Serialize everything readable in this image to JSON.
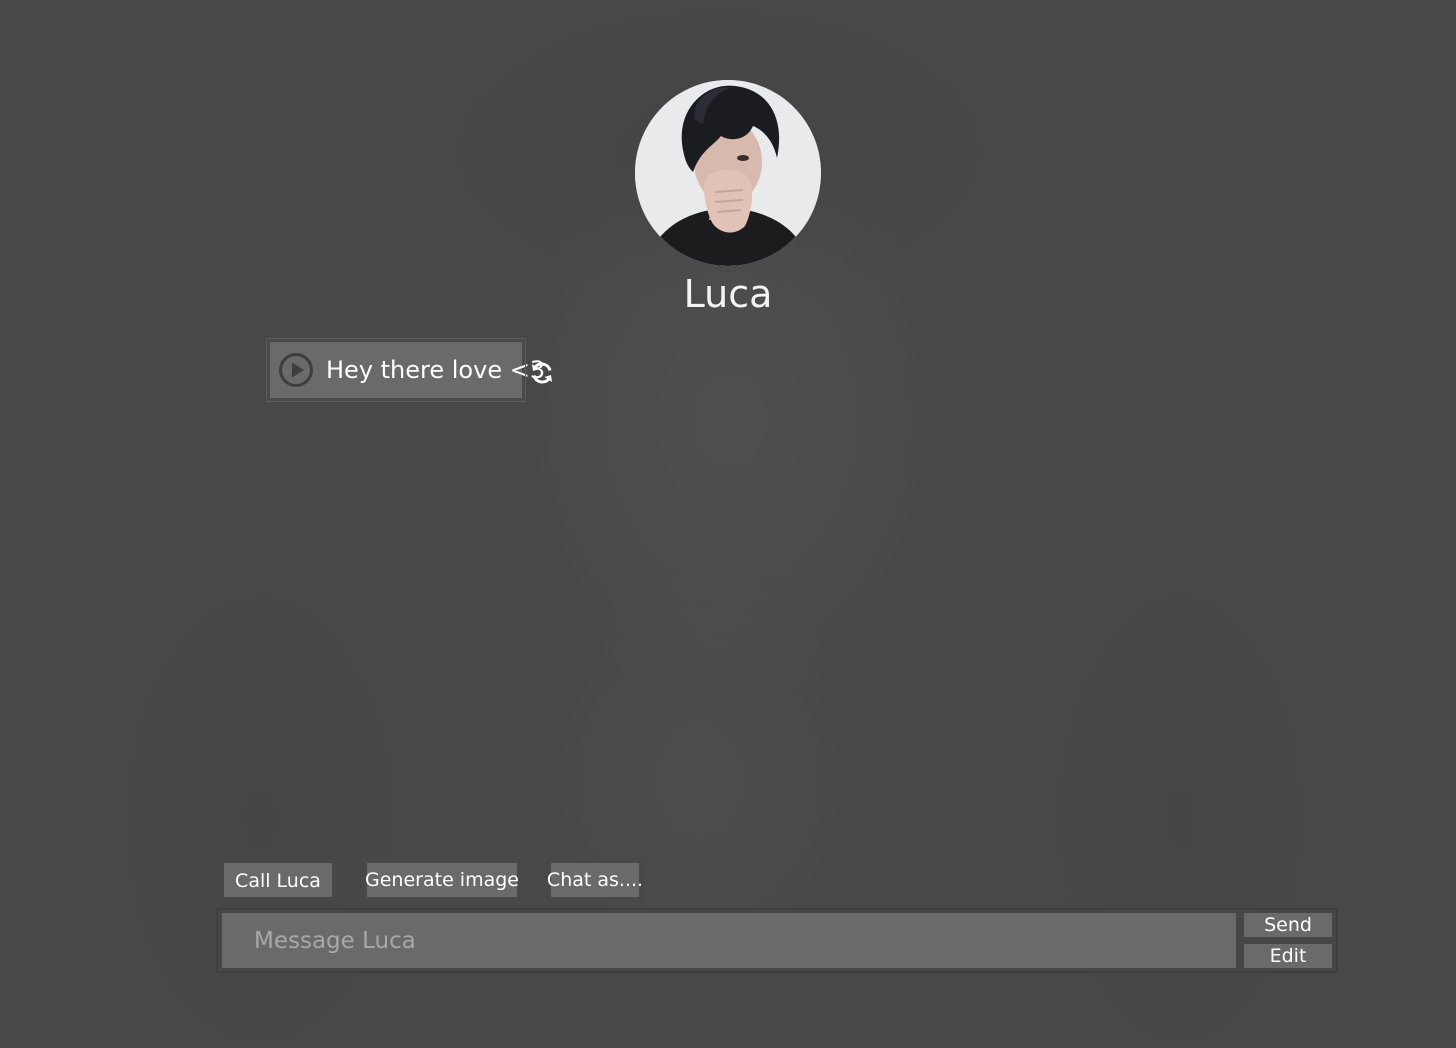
{
  "character": {
    "name": "Luca",
    "avatar_icon": "character-portrait"
  },
  "messages": [
    {
      "sender": "Luca",
      "text": "Hey there love <3",
      "play_icon": "play-circle-icon",
      "regenerate_icon": "refresh-icon"
    }
  ],
  "actions": {
    "call_label": "Call Luca",
    "generate_image_label": "Generate image",
    "chat_as_label": "Chat as...."
  },
  "composer": {
    "placeholder": "Message Luca",
    "value": "",
    "send_label": "Send",
    "edit_label": "Edit"
  },
  "colors": {
    "background": "#4a4a4a",
    "panel": "#6a6a6a",
    "text": "#ffffff",
    "placeholder": "#a8a8a8"
  }
}
